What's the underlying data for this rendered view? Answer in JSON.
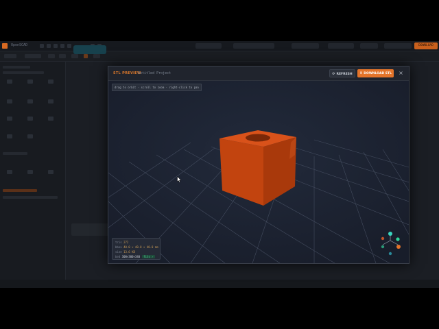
{
  "app": {
    "name": "OpenSCAD",
    "download_label": "DOWNLOAD",
    "status_text": ""
  },
  "modal": {
    "title": "STL PREVIEW",
    "subtitle": "Untitled Project",
    "refresh_label": "REFRESH",
    "refresh_icon": "refresh-icon",
    "download_label": "DOWNLOAD STL",
    "download_icon": "download-icon",
    "close_label": "×",
    "hint": "drag to orbit · scroll to zoom · right-click to pan",
    "stats": {
      "tris_label": "tris",
      "tris_value": "272",
      "bbox_label": "bbox",
      "bbox_value": "40.0 × 40.0 × 40.0 mm",
      "size_label": "size",
      "size_value": "13.6 KB",
      "bed_label": "bed",
      "bed_value": "300×300×340",
      "fits_label": "fits ✓"
    }
  },
  "colors": {
    "accent": "#e4742a",
    "model": "#c2440f",
    "viewport_bg": "#1c2232",
    "fits_badge": "#58d39a"
  },
  "axis_gizmo": {
    "y_color": "#3ad6c0",
    "x_color": "#e4742a",
    "z_color": "#2fd39a"
  }
}
